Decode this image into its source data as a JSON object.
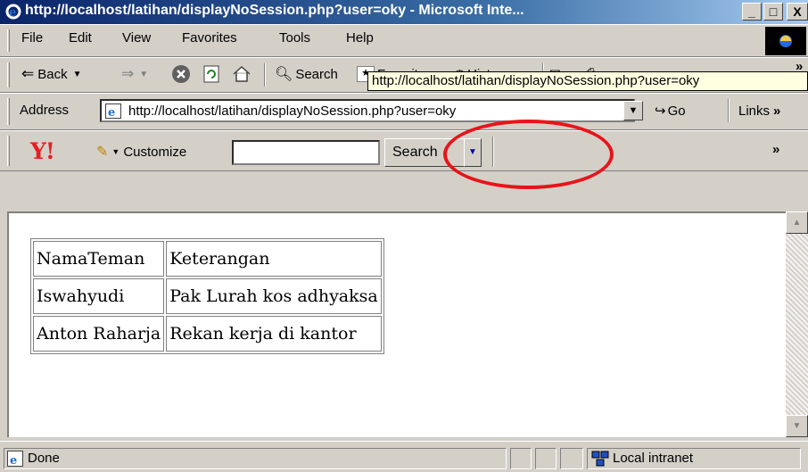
{
  "window": {
    "title": "http://localhost/latihan/displayNoSession.php?user=oky - Microsoft Inte...",
    "controls": {
      "minimize": "_",
      "maximize": "□",
      "close": "X"
    }
  },
  "menu": {
    "items": [
      {
        "label": "File"
      },
      {
        "label": "Edit"
      },
      {
        "label": "View"
      },
      {
        "label": "Favorites"
      },
      {
        "label": "Tools"
      },
      {
        "label": "Help"
      }
    ]
  },
  "tooltip": {
    "text": "http://localhost/latihan/displayNoSession.php?user=oky"
  },
  "toolbar": {
    "back": "Back",
    "forward_arrow": "⇒",
    "search": "Search",
    "favorites": "Favorites",
    "history": "History",
    "more": "»"
  },
  "address": {
    "label": "Address",
    "value": "http://localhost/latihan/displayNoSession.php?user=oky",
    "go": "Go",
    "links": "Links",
    "links_more": "»"
  },
  "yahoo": {
    "logo": "Y!",
    "customize": "Customize",
    "search_value": "",
    "search_button": "Search",
    "more": "»"
  },
  "table": {
    "rows": [
      [
        "NamaTeman",
        "Keterangan"
      ],
      [
        "Iswahyudi",
        "Pak Lurah kos adhyaksa"
      ],
      [
        "Anton Raharja",
        "Rekan kerja di kantor"
      ]
    ]
  },
  "status": {
    "text": "Done",
    "zone": "Local intranet"
  },
  "colors": {
    "titlebar_start": "#0a246a",
    "titlebar_end": "#a6caf0",
    "highlight_oval": "#e8141a",
    "chrome": "#d4d0c8"
  }
}
